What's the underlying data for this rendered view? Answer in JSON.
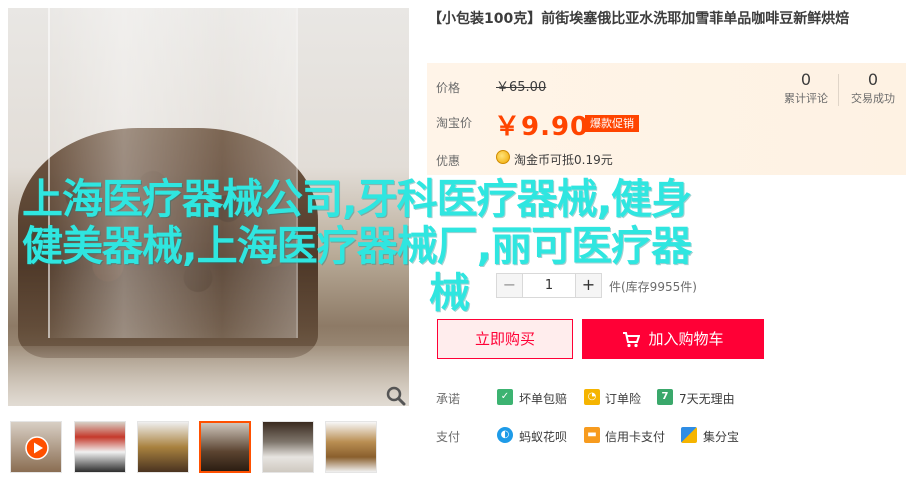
{
  "product": {
    "title": "【小包装100克】前街埃塞俄比亚水洗耶加雪菲单品咖啡豆新鲜烘焙"
  },
  "pricing": {
    "orig_label": "价格",
    "orig_price": "￥65.00",
    "sale_label": "淘宝价",
    "sale_price": "￥9.90",
    "promo_badge": "爆款促销",
    "discount_label": "优惠",
    "coin_text": "淘金币可抵0.19元",
    "reviews_count": "0",
    "reviews_label": "累计评论",
    "sales_count": "0",
    "sales_label": "交易成功"
  },
  "quantity": {
    "minus": "−",
    "value": "1",
    "plus": "+",
    "stock": "件(库存9955件)"
  },
  "actions": {
    "buy_now": "立即购买",
    "add_to_cart": "加入购物车"
  },
  "services": {
    "promise_label": "承诺",
    "items": [
      "坏单包赔",
      "订单险",
      "7天无理由"
    ],
    "payment_label": "支付",
    "pay_items": [
      "蚂蚁花呗",
      "信用卡支付",
      "集分宝"
    ]
  },
  "overlay": {
    "line1": "上海医疗器械公司,牙科医疗器械,健身",
    "line2": "健美器械,上海医疗器械厂,丽可医疗器",
    "line3": "械"
  },
  "colors": {
    "accent": "#ff4400",
    "cart_red": "#ff0036",
    "overlay_cyan": "#2fe6e0"
  },
  "icons": [
    "zoom-icon",
    "play-icon",
    "cart-icon",
    "coin-icon",
    "shield-icon",
    "clock-icon",
    "seven-day-icon",
    "huabei-icon",
    "credit-card-icon",
    "jifenbao-icon"
  ]
}
